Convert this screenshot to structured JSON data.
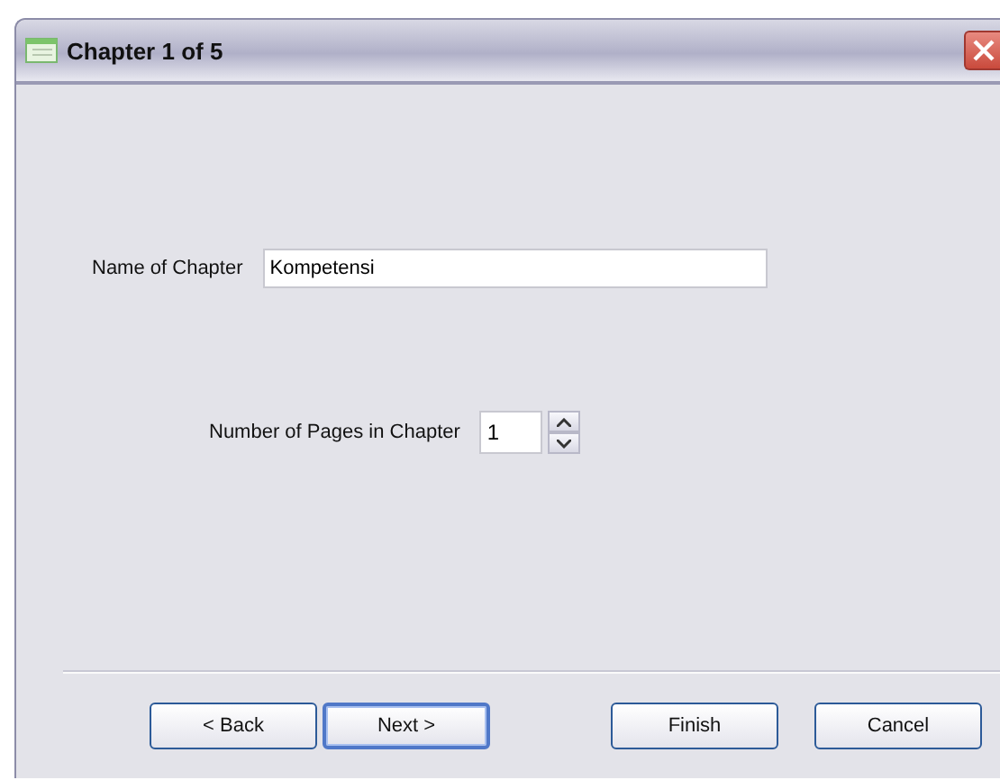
{
  "window": {
    "title": "Chapter 1 of 5"
  },
  "name_field": {
    "label": "Name of Chapter",
    "value": "Kompetensi"
  },
  "pages_field": {
    "label": "Number of Pages in Chapter",
    "value": "1"
  },
  "buttons": [
    {
      "label": "< Back",
      "default": false
    },
    {
      "label": "Next >",
      "default": true
    },
    {
      "label": "Finish",
      "default": false
    },
    {
      "label": "Cancel",
      "default": false
    }
  ]
}
